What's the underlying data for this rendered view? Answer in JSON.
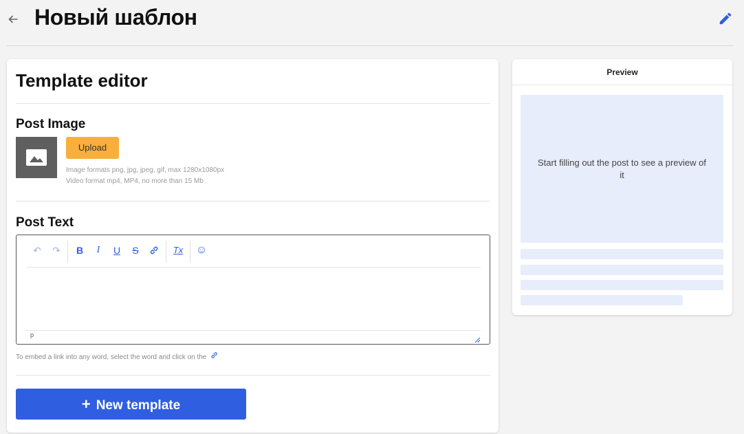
{
  "header": {
    "title": "Новый шаблон",
    "back_icon": "arrow-left-icon",
    "edit_icon": "pencil-icon"
  },
  "editor": {
    "title": "Template editor",
    "post_image": {
      "heading": "Post Image",
      "upload_label": "Upload",
      "hint_line1": "Image formats png, jpg, jpeg, gif, max 1280x1080px",
      "hint_line2": "Video format mp4, MP4, no more than 15 Mb"
    },
    "post_text": {
      "heading": "Post Text",
      "toolbar": {
        "undo": "↶",
        "redo": "↷",
        "bold": "B",
        "italic": "I",
        "underline": "U",
        "strike": "S",
        "link": "🔗",
        "clear_format": "Tx",
        "emoji": "☺"
      },
      "body_value": "",
      "status_path": "p"
    },
    "embed_hint": "To embed a link into any word, select the word and click on the",
    "new_template_label": "New template"
  },
  "preview": {
    "heading": "Preview",
    "message": "Start filling out the post to see a preview of it"
  },
  "colors": {
    "accent": "#2f5fe0",
    "upload": "#f8af3c",
    "preview_fill": "#e7edfa"
  }
}
